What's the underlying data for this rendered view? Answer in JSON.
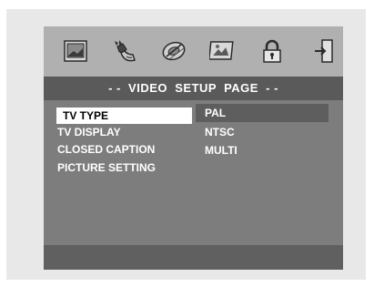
{
  "icons": [
    "general-setup-icon",
    "audio-setup-icon",
    "dolby-digital-setup-icon",
    "video-setup-icon",
    "preference-lock-icon",
    "exit-icon"
  ],
  "title": "- -  VIDEO  SETUP  PAGE  - -",
  "menu": {
    "items": [
      {
        "label": "TV TYPE",
        "selected": true
      },
      {
        "label": "TV DISPLAY"
      },
      {
        "label": "CLOSED CAPTION"
      },
      {
        "label": "PICTURE SETTING"
      }
    ]
  },
  "options": {
    "items": [
      {
        "label": "PAL",
        "selected": true
      },
      {
        "label": "NTSC"
      },
      {
        "label": "MULTI"
      }
    ]
  },
  "colors": {
    "osd_background": "#7d7d7d",
    "icon_bar": "#b0b0b0",
    "title_bar": "#5a5a5a",
    "selection_highlight": "#ffffff",
    "option_highlight": "#5e5e5e"
  }
}
